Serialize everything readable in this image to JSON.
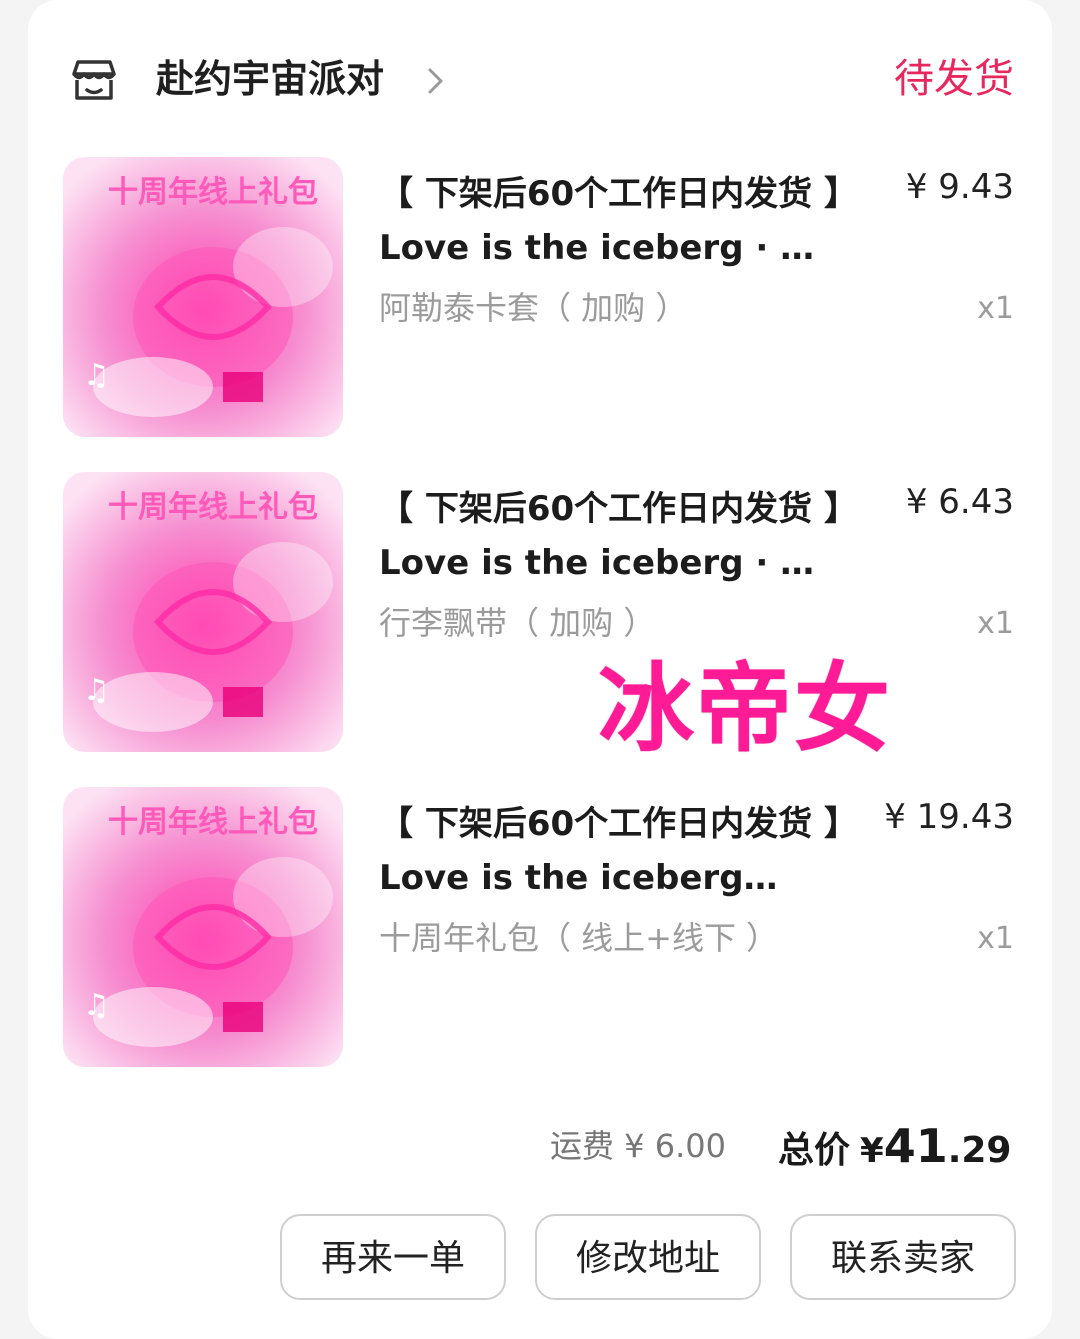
{
  "shop": {
    "name": "赴约宇宙派对",
    "status": "待发货",
    "icon": "store-icon"
  },
  "items": [
    {
      "title": "【 下架后60个工作日内发货 】Love is the iceberg · …",
      "price": "¥ 9.43",
      "variant": "阿勒泰卡套（ 加购 ）",
      "qty": "x1"
    },
    {
      "title": "【 下架后60个工作日内发货 】Love is the iceberg · …",
      "price": "¥ 6.43",
      "variant": "行李飘带（ 加购 ）",
      "qty": "x1"
    },
    {
      "title": "【 下架后60个工作日内发货 】Love is the iceberg…",
      "price": "¥ 19.43",
      "variant": "十周年礼包（ 线上+线下 ）",
      "qty": "x1"
    }
  ],
  "thumbnail_text": "十周年线上礼包",
  "sticker": "冰帝女",
  "summary": {
    "shipping": "运费 ¥ 6.00",
    "total_label": "总价",
    "currency": "¥",
    "total_int": "41",
    "total_dec": ".29"
  },
  "actions": {
    "reorder": "再来一单",
    "edit_address": "修改地址",
    "contact_seller": "联系卖家"
  },
  "colors": {
    "status": "#e8275e",
    "sticker": "#ff1b95",
    "thumb": "#f58fcf"
  }
}
